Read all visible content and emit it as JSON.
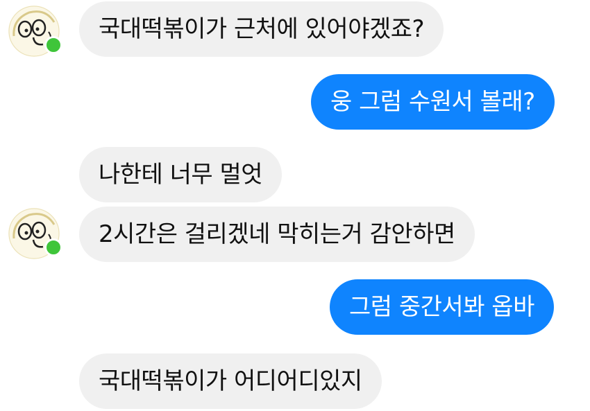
{
  "colors": {
    "incoming_bubble": "#f0f0f0",
    "outgoing_bubble": "#0f84fe",
    "presence_dot": "#3fc53a"
  },
  "messages": [
    {
      "direction": "incoming",
      "text": "국대떡볶이가 근처에 있어야겠죠?",
      "has_avatar": true
    },
    {
      "direction": "outgoing",
      "text": "웅 그럼 수원서 볼래?"
    },
    {
      "direction": "incoming",
      "text": "나한테 너무 멀엇",
      "has_avatar": false
    },
    {
      "direction": "incoming",
      "text": "2시간은 걸리겠네 막히는거 감안하면",
      "has_avatar": true
    },
    {
      "direction": "outgoing",
      "text": "그럼 중간서봐 옵바"
    },
    {
      "direction": "incoming",
      "text": "국대떡볶이가 어디어디있지",
      "has_avatar": false
    }
  ],
  "avatar_icon": "cartoon-face-avatar-icon"
}
